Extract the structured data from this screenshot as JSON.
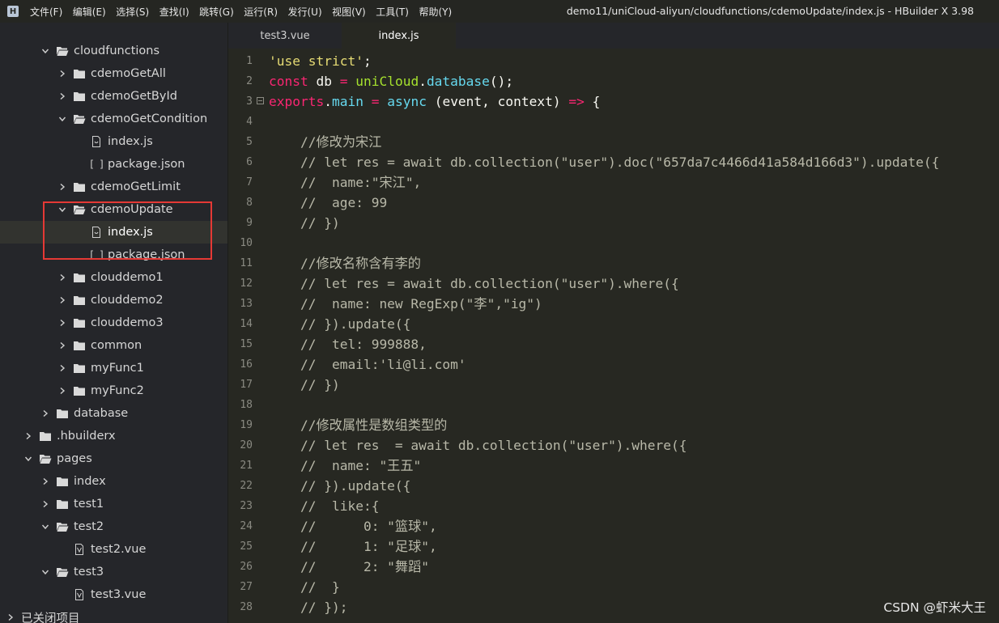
{
  "menu": [
    "文件(F)",
    "编辑(E)",
    "选择(S)",
    "查找(I)",
    "跳转(G)",
    "运行(R)",
    "发行(U)",
    "视图(V)",
    "工具(T)",
    "帮助(Y)"
  ],
  "window_title": "demo11/uniCloud-aliyun/cloudfunctions/cdemoUpdate/index.js - HBuilder X 3.98",
  "tabs": [
    {
      "label": "test3.vue",
      "active": false
    },
    {
      "label": "index.js",
      "active": true
    }
  ],
  "tree": [
    {
      "label": "cloudfunctions",
      "depth": 2,
      "expanded": true,
      "type": "folder"
    },
    {
      "label": "cdemoGetAll",
      "depth": 3,
      "expanded": false,
      "type": "folder"
    },
    {
      "label": "cdemoGetById",
      "depth": 3,
      "expanded": false,
      "type": "folder"
    },
    {
      "label": "cdemoGetCondition",
      "depth": 3,
      "expanded": true,
      "type": "folder"
    },
    {
      "label": "index.js",
      "depth": 4,
      "type": "file"
    },
    {
      "label": "package.json",
      "depth": 4,
      "type": "json"
    },
    {
      "label": "cdemoGetLimit",
      "depth": 3,
      "expanded": false,
      "type": "folder"
    },
    {
      "label": "cdemoUpdate",
      "depth": 3,
      "expanded": true,
      "type": "folder"
    },
    {
      "label": "index.js",
      "depth": 4,
      "type": "file",
      "selected": true
    },
    {
      "label": "package.json",
      "depth": 4,
      "type": "json"
    },
    {
      "label": "clouddemo1",
      "depth": 3,
      "expanded": false,
      "type": "folder"
    },
    {
      "label": "clouddemo2",
      "depth": 3,
      "expanded": false,
      "type": "folder"
    },
    {
      "label": "clouddemo3",
      "depth": 3,
      "expanded": false,
      "type": "folder"
    },
    {
      "label": "common",
      "depth": 3,
      "expanded": false,
      "type": "folder"
    },
    {
      "label": "myFunc1",
      "depth": 3,
      "expanded": false,
      "type": "folder"
    },
    {
      "label": "myFunc2",
      "depth": 3,
      "expanded": false,
      "type": "folder"
    },
    {
      "label": "database",
      "depth": 2,
      "expanded": false,
      "type": "folder"
    },
    {
      "label": ".hbuilderx",
      "depth": 1,
      "expanded": false,
      "type": "folder"
    },
    {
      "label": "pages",
      "depth": 1,
      "expanded": true,
      "type": "folder"
    },
    {
      "label": "index",
      "depth": 2,
      "expanded": false,
      "type": "folder"
    },
    {
      "label": "test1",
      "depth": 2,
      "expanded": false,
      "type": "folder"
    },
    {
      "label": "test2",
      "depth": 2,
      "expanded": true,
      "type": "folder"
    },
    {
      "label": "test2.vue",
      "depth": 3,
      "type": "vue"
    },
    {
      "label": "test3",
      "depth": 2,
      "expanded": true,
      "type": "folder"
    },
    {
      "label": "test3.vue",
      "depth": 3,
      "type": "vue"
    },
    {
      "label": "已关闭项目",
      "depth": 0,
      "expanded": false,
      "type": "section"
    }
  ],
  "code_lines": [
    [
      [
        "c-str",
        "'use strict'"
      ],
      [
        "c-plain",
        ";"
      ]
    ],
    [
      [
        "c-kw",
        "const"
      ],
      [
        "c-plain",
        " db "
      ],
      [
        "c-kw",
        "="
      ],
      [
        "c-plain",
        " "
      ],
      [
        "c-fn",
        "uniCloud"
      ],
      [
        "c-plain",
        "."
      ],
      [
        "c-obj",
        "database"
      ],
      [
        "c-plain",
        "();"
      ]
    ],
    [
      [
        "c-kw",
        "exports"
      ],
      [
        "c-plain",
        "."
      ],
      [
        "c-obj",
        "main"
      ],
      [
        "c-plain",
        " "
      ],
      [
        "c-kw",
        "="
      ],
      [
        "c-plain",
        " "
      ],
      [
        "c-obj",
        "async"
      ],
      [
        "c-plain",
        " (event, context) "
      ],
      [
        "c-kw",
        "=>"
      ],
      [
        "c-plain",
        " {"
      ]
    ],
    [],
    [
      [
        "c-cmt",
        "    //修改为宋江"
      ]
    ],
    [
      [
        "c-cmt",
        "    // let res = await db.collection(\"user\").doc(\"657da7c4466d41a584d166d3\").update({"
      ]
    ],
    [
      [
        "c-cmt",
        "    //  name:\"宋江\","
      ]
    ],
    [
      [
        "c-cmt",
        "    //  age: 99"
      ]
    ],
    [
      [
        "c-cmt",
        "    // })"
      ]
    ],
    [],
    [
      [
        "c-cmt",
        "    //修改名称含有李的"
      ]
    ],
    [
      [
        "c-cmt",
        "    // let res = await db.collection(\"user\").where({"
      ]
    ],
    [
      [
        "c-cmt",
        "    //  name: new RegExp(\"李\",\"ig\")"
      ]
    ],
    [
      [
        "c-cmt",
        "    // }).update({"
      ]
    ],
    [
      [
        "c-cmt",
        "    //  tel: 999888,"
      ]
    ],
    [
      [
        "c-cmt",
        "    //  email:'li@li.com'"
      ]
    ],
    [
      [
        "c-cmt",
        "    // })"
      ]
    ],
    [],
    [
      [
        "c-cmt",
        "    //修改属性是数组类型的"
      ]
    ],
    [
      [
        "c-cmt",
        "    // let res  = await db.collection(\"user\").where({"
      ]
    ],
    [
      [
        "c-cmt",
        "    //  name: \"王五\""
      ]
    ],
    [
      [
        "c-cmt",
        "    // }).update({"
      ]
    ],
    [
      [
        "c-cmt",
        "    //  like:{"
      ]
    ],
    [
      [
        "c-cmt",
        "    //      0: \"篮球\","
      ]
    ],
    [
      [
        "c-cmt",
        "    //      1: \"足球\","
      ]
    ],
    [
      [
        "c-cmt",
        "    //      2: \"舞蹈\""
      ]
    ],
    [
      [
        "c-cmt",
        "    //  }"
      ]
    ],
    [
      [
        "c-cmt",
        "    // });"
      ]
    ]
  ],
  "watermark": "CSDN @虾米大王",
  "colors": {
    "background": "#272822",
    "sidebar": "#25262a",
    "highlight_box": "#e53935"
  }
}
